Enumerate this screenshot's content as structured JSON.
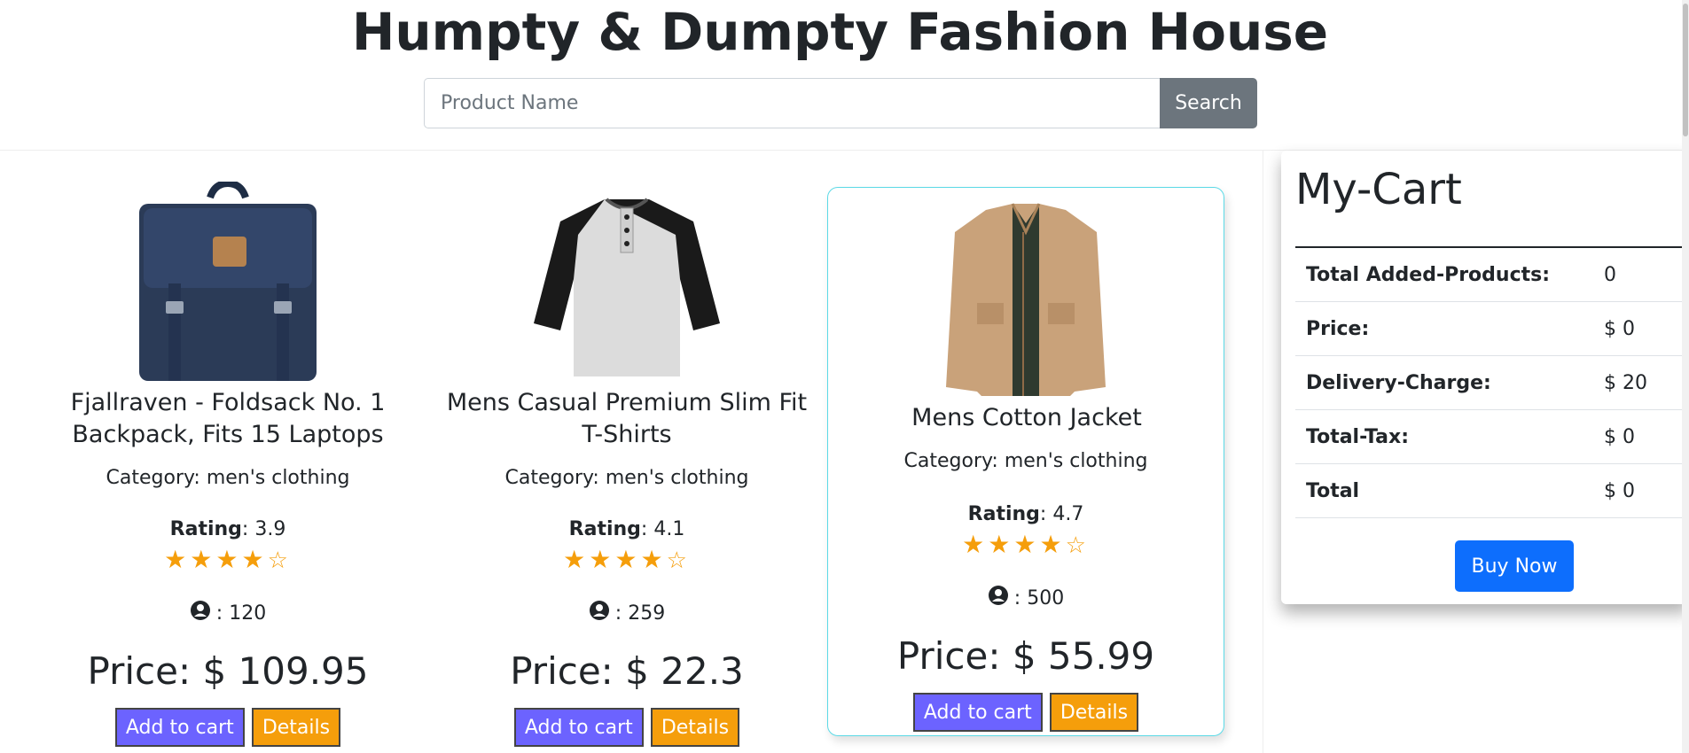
{
  "header": {
    "title": "Humpty & Dumpty Fashion House",
    "search_placeholder": "Product Name",
    "search_label": "Search"
  },
  "products": [
    {
      "title": "Fjallraven - Foldsack No. 1 Backpack, Fits 15 Laptops",
      "category": "Category: men's clothing",
      "rating_label": "Rating",
      "rating": ": 3.9",
      "count": ": 120",
      "price": "Price: $ 109.95",
      "add_label": "Add to cart",
      "details_label": "Details",
      "image": "backpack"
    },
    {
      "title": "Mens Casual Premium Slim Fit T-Shirts",
      "category": "Category: men's clothing",
      "rating_label": "Rating",
      "rating": ": 4.1",
      "count": ": 259",
      "price": "Price: $ 22.3",
      "add_label": "Add to cart",
      "details_label": "Details",
      "image": "t-shirt"
    },
    {
      "title": "Mens Cotton Jacket",
      "category": "Category: men's clothing",
      "rating_label": "Rating",
      "rating": ": 4.7",
      "count": ": 500",
      "price": "Price: $ 55.99",
      "add_label": "Add to cart",
      "details_label": "Details",
      "image": "jacket"
    }
  ],
  "cart": {
    "title": "My-Cart",
    "rows": [
      {
        "label": "Total Added-Products:",
        "value": "0"
      },
      {
        "label": "Price:",
        "value": "$ 0"
      },
      {
        "label": "Delivery-Charge:",
        "value": "$ 20"
      },
      {
        "label": "Total-Tax:",
        "value": "$ 0"
      },
      {
        "label": "Total",
        "value": "$ 0"
      }
    ],
    "buy_label": "Buy Now"
  },
  "colors": {
    "accent_cart": "#6c63ff",
    "accent_details": "#f59e0b",
    "buy": "#0d6efd",
    "search": "#6c757d",
    "star": "#f59e0b"
  }
}
